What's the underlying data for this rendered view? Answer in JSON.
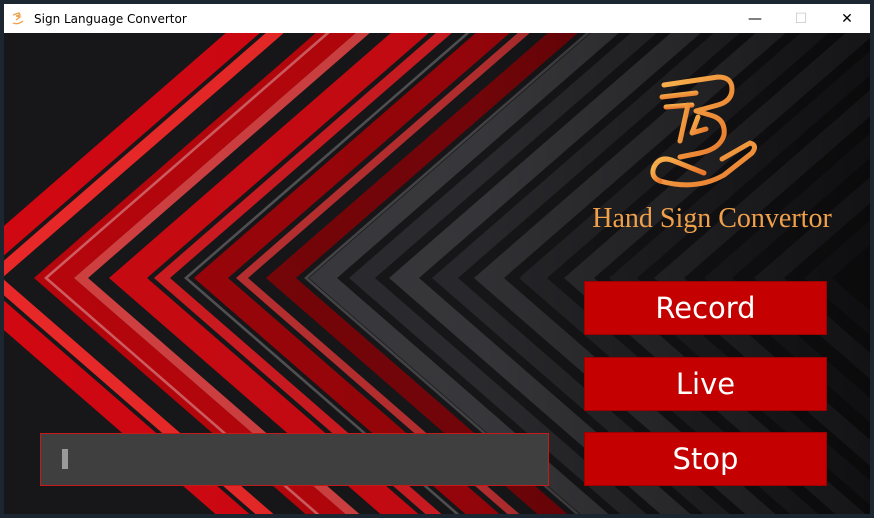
{
  "window": {
    "title": "Sign Language Convertor",
    "controls": {
      "minimize": "—",
      "maximize": "☐",
      "close": "✕"
    }
  },
  "brand": {
    "name": "Hand Sign Convertor",
    "color": "#f0a04a"
  },
  "buttons": {
    "record": "Record",
    "live": "Live",
    "stop": "Stop"
  },
  "output": {
    "value": "",
    "placeholder": ""
  },
  "colors": {
    "button_bg": "#c50000",
    "output_bg": "#3f3f3f",
    "output_border": "#c41a1a",
    "accent_red": "#e10f18"
  },
  "icons": {
    "app": "hand-sign-icon",
    "logo": "hand-sign-logo-icon"
  }
}
